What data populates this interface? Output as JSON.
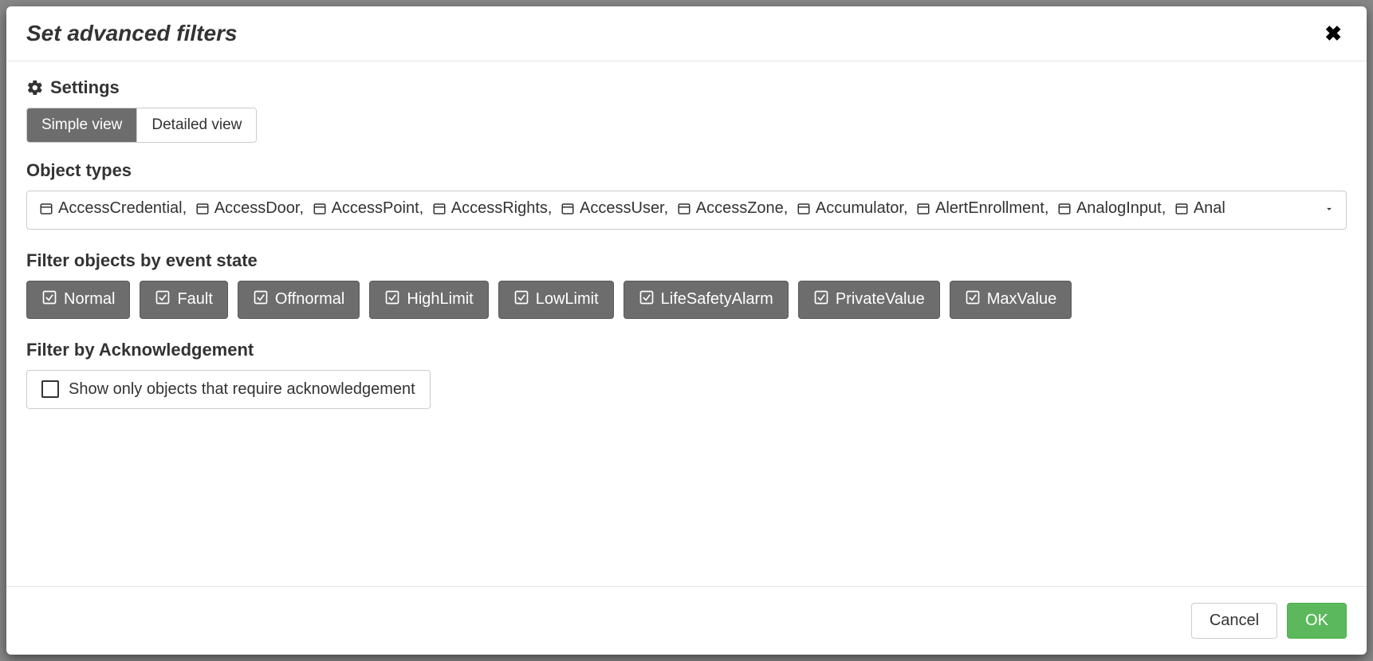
{
  "dialog": {
    "title": "Set advanced filters",
    "settings_label": "Settings",
    "view_toggle": {
      "simple": "Simple view",
      "detailed": "Detailed view",
      "active": "simple"
    },
    "object_types": {
      "label": "Object types",
      "items": [
        {
          "icon": "id-card",
          "label": "AccessCredential,"
        },
        {
          "icon": "door",
          "label": "AccessDoor,"
        },
        {
          "icon": "point",
          "label": "AccessPoint,"
        },
        {
          "icon": "rights",
          "label": "AccessRights,"
        },
        {
          "icon": "user",
          "label": "AccessUser,"
        },
        {
          "icon": "zone",
          "label": "AccessZone,"
        },
        {
          "icon": "accumulator",
          "label": "Accumulator,"
        },
        {
          "icon": "alert",
          "label": "AlertEnrollment,"
        },
        {
          "icon": "analog-in",
          "label": "AnalogInput,"
        },
        {
          "icon": "analog",
          "label": "Anal"
        }
      ]
    },
    "event_state": {
      "label": "Filter objects by event state",
      "items": [
        "Normal",
        "Fault",
        "Offnormal",
        "HighLimit",
        "LowLimit",
        "LifeSafetyAlarm",
        "PrivateValue",
        "MaxValue"
      ]
    },
    "acknowledgement": {
      "label": "Filter by Acknowledgement",
      "checkbox_label": "Show only objects that require acknowledgement",
      "checked": false
    },
    "footer": {
      "cancel": "Cancel",
      "ok": "OK"
    }
  }
}
